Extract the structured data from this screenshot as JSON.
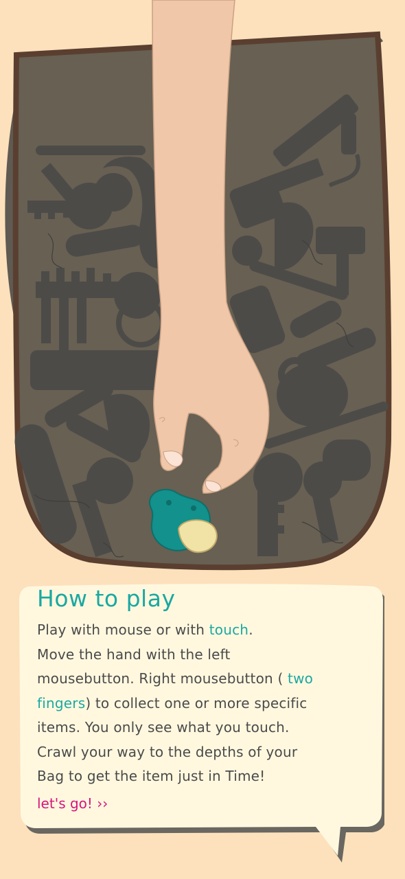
{
  "colors": {
    "background": "#FCE1BC",
    "bag_fill": "#676053",
    "bag_border": "#5A3F30",
    "bag_strap": "#5F5A52",
    "silhouette": "#4D4B48",
    "skin": "#F0C7A8",
    "pacifier": "#13918C",
    "pacifier_nipple": "#F1E2A6",
    "dialog_fill": "#FFF8DF",
    "dialog_shadow": "#6A6660",
    "accent_teal": "#1BA8A1",
    "accent_pink": "#D5147E",
    "text": "#4A4A4A"
  },
  "game": {
    "target_item": "pacifier-icon",
    "bag_items": [
      "key-icon",
      "key-icon",
      "key-icon",
      "key-icon",
      "padlock-icon",
      "pen-icon",
      "lipstick-icon",
      "usb-cable-icon",
      "hairdryer-icon",
      "comb-icon",
      "brush-icon"
    ]
  },
  "howto": {
    "title": "How to play",
    "line1_a": "Play with mouse or with ",
    "line1_touch": "touch",
    "line1_b": ".",
    "line2": "Move the hand with the left",
    "line3_a": "mousebutton. Right mousebutton ( ",
    "line3_two": "two",
    "line4_fingers": "fingers",
    "line4_b": ") to collect one or more specific",
    "line5": "items. You only see what you touch.",
    "line6": "Crawl your way to the depths of your",
    "line7": "Bag to get the item just in Time!",
    "start_label": "let's go! ››"
  }
}
